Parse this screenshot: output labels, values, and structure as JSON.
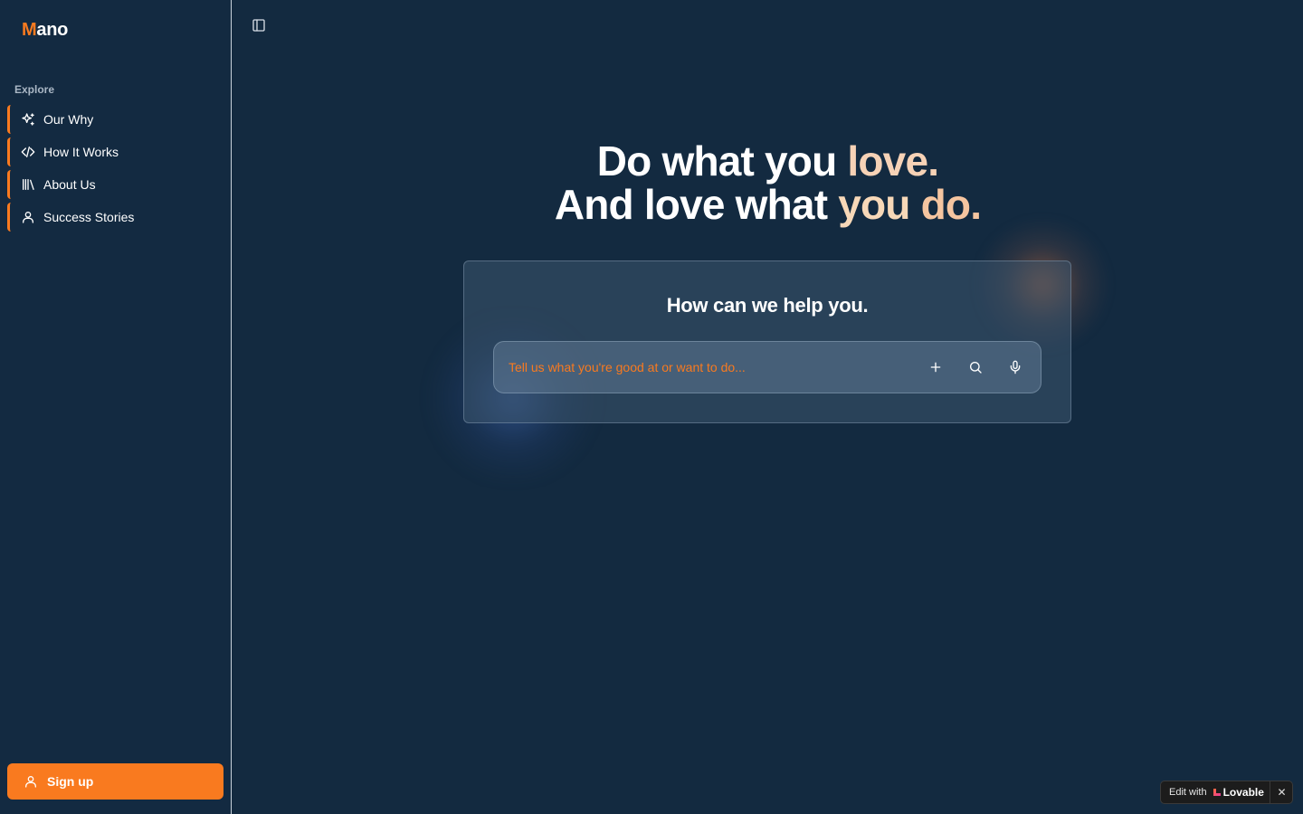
{
  "app": {
    "logo_first": "M",
    "logo_rest": "ano"
  },
  "sidebar": {
    "section_label": "Explore",
    "items": [
      {
        "label": "Our Why",
        "icon": "sparkles-icon"
      },
      {
        "label": "How It Works",
        "icon": "code-icon"
      },
      {
        "label": "About Us",
        "icon": "library-icon"
      },
      {
        "label": "Success Stories",
        "icon": "user-icon"
      }
    ],
    "signup_label": "Sign up"
  },
  "hero": {
    "line1_part1": "Do what you ",
    "line1_part2": "love.",
    "line2_part1": "And love what ",
    "line2_part2": "you ",
    "line2_part3": "do."
  },
  "card": {
    "title": "How can we help you.",
    "search_placeholder": "Tell us what you're good at or want to do..."
  },
  "badge": {
    "edit_label": "Edit with",
    "brand": "Lovable",
    "close": "✕"
  },
  "colors": {
    "background": "#132a40",
    "accent": "#f97a1f",
    "hero_highlight": "#f6d2b6"
  }
}
